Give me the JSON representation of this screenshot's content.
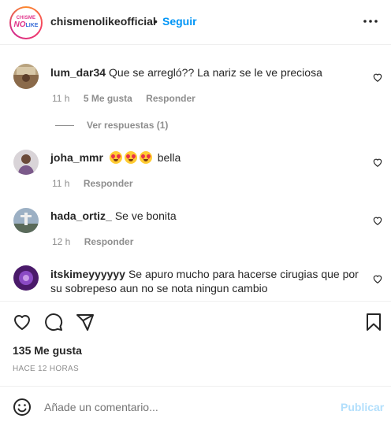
{
  "header": {
    "logo_top": "CHISME",
    "logo_no": "NO",
    "logo_like": "LIKE",
    "account": "chismenolikeofficial",
    "separator": "•",
    "follow_label": "Seguir",
    "more_icon": "more-options-icon"
  },
  "comments": [
    {
      "user": "lum_dar34",
      "text": "Que se arregló?? La nariz se le ve preciosa",
      "time": "11 h",
      "likes": "5 Me gusta",
      "reply": "Responder",
      "view_replies": "Ver respuestas (1)"
    },
    {
      "user": "joha_mmr",
      "text": "bella",
      "emoji": "smiling-face-with-heart-eyes",
      "time": "11 h",
      "reply": "Responder"
    },
    {
      "user": "hada_ortiz_",
      "text": "Se ve bonita",
      "time": "12 h",
      "reply": "Responder"
    },
    {
      "user": "itskimeyyyyyy",
      "text": "Se apuro mucho para hacerse cirugias que por su sobrepeso aun no se nota ningun cambio"
    }
  ],
  "post": {
    "likes": "135 Me gusta",
    "time": "HACE 12 HORAS"
  },
  "add_comment": {
    "placeholder": "Añade un comentario...",
    "publish_label": "Publicar"
  },
  "colors": {
    "accent": "#0095f6",
    "publish_disabled": "#b2dffc",
    "muted": "#8e8e8e"
  }
}
